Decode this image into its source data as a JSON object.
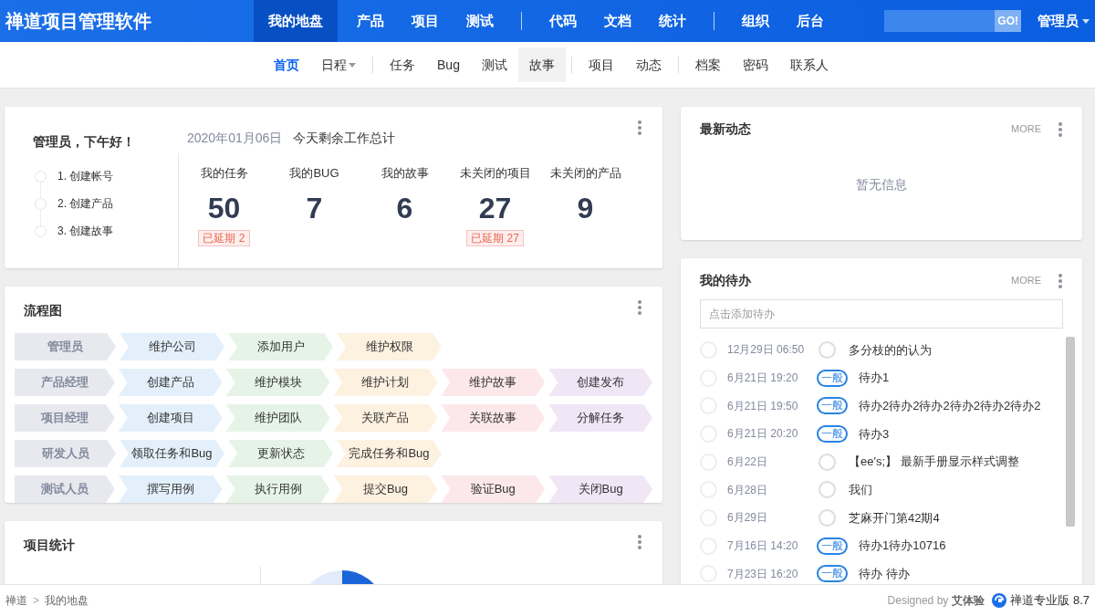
{
  "app": {
    "title": "禅道项目管理软件"
  },
  "nav": {
    "groups": [
      [
        {
          "label": "我的地盘",
          "selected": true
        },
        {
          "label": "产品",
          "selected": false
        },
        {
          "label": "项目",
          "selected": false
        },
        {
          "label": "测试",
          "selected": false
        }
      ],
      [
        {
          "label": "代码",
          "selected": false
        },
        {
          "label": "文档",
          "selected": false
        },
        {
          "label": "统计",
          "selected": false
        }
      ],
      [
        {
          "label": "组织",
          "selected": false
        },
        {
          "label": "后台",
          "selected": false
        }
      ]
    ],
    "search_button": "GO!",
    "user": "管理员"
  },
  "subnav": {
    "groups": [
      [
        {
          "label": "首页",
          "selected": true,
          "dropdown": false,
          "hovered": false
        },
        {
          "label": "日程",
          "selected": false,
          "dropdown": true,
          "hovered": false
        }
      ],
      [
        {
          "label": "任务",
          "selected": false,
          "dropdown": false,
          "hovered": false
        },
        {
          "label": "Bug",
          "selected": false,
          "dropdown": false,
          "hovered": false
        },
        {
          "label": "测试",
          "selected": false,
          "dropdown": false,
          "hovered": false
        },
        {
          "label": "故事",
          "selected": false,
          "dropdown": false,
          "hovered": true
        }
      ],
      [
        {
          "label": "项目",
          "selected": false,
          "dropdown": false,
          "hovered": false
        },
        {
          "label": "动态",
          "selected": false,
          "dropdown": false,
          "hovered": false
        }
      ],
      [
        {
          "label": "档案",
          "selected": false,
          "dropdown": false,
          "hovered": false
        },
        {
          "label": "密码",
          "selected": false,
          "dropdown": false,
          "hovered": false
        },
        {
          "label": "联系人",
          "selected": false,
          "dropdown": false,
          "hovered": false
        }
      ]
    ]
  },
  "welcome": {
    "greeting": "管理员，下午好！",
    "steps": [
      "1. 创建帐号",
      "2. 创建产品",
      "3. 创建故事"
    ],
    "date": "2020年01月06日",
    "summary_title": "今天剩余工作总计",
    "stats": [
      {
        "label": "我的任务",
        "value": "50",
        "overdue": "已延期 2"
      },
      {
        "label": "我的BUG",
        "value": "7"
      },
      {
        "label": "我的故事",
        "value": "6"
      },
      {
        "label": "未关闭的项目",
        "value": "27",
        "overdue": "已延期 27"
      },
      {
        "label": "未关闭的产品",
        "value": "9"
      }
    ]
  },
  "flowchart": {
    "title": "流程图",
    "rows": [
      {
        "role": "管理员",
        "steps": [
          "维护公司",
          "添加用户",
          "维护权限"
        ]
      },
      {
        "role": "产品经理",
        "steps": [
          "创建产品",
          "维护模块",
          "维护计划",
          "维护故事",
          "创建发布"
        ]
      },
      {
        "role": "项目经理",
        "steps": [
          "创建项目",
          "维护团队",
          "关联产品",
          "关联故事",
          "分解任务"
        ]
      },
      {
        "role": "研发人员",
        "steps": [
          "领取任务和Bug",
          "更新状态",
          "完成任务和Bug"
        ]
      },
      {
        "role": "测试人员",
        "steps": [
          "撰写用例",
          "执行用例",
          "提交Bug",
          "验证Bug",
          "关闭Bug"
        ]
      }
    ]
  },
  "project_stats": {
    "title": "项目统计"
  },
  "activity": {
    "title": "最新动态",
    "more": "MORE",
    "empty": "暂无信息"
  },
  "todos": {
    "title": "我的待办",
    "more": "MORE",
    "placeholder": "点击添加待办",
    "items": [
      {
        "date": "12月29日 06:50",
        "title": "多分枝的的认为",
        "checked": false
      },
      {
        "date": "6月21日 19:20",
        "priority": "一般",
        "title": "待办1",
        "checked": false
      },
      {
        "date": "6月21日 19:50",
        "priority": "一般",
        "title": "待办2待办2待办2待办2待办2待办2",
        "checked": false
      },
      {
        "date": "6月21日 20:20",
        "priority": "一般",
        "title": "待办3",
        "checked": false
      },
      {
        "date": "6月22日",
        "title": "【ee's;】 最新手册显示样式调整",
        "checked": false
      },
      {
        "date": "6月28日",
        "title": "我们",
        "checked": false
      },
      {
        "date": "6月29日",
        "title": "芝麻开门第42期4",
        "checked": false
      },
      {
        "date": "7月16日 14:20",
        "priority": "一般",
        "title": "待办1待办10716",
        "checked": false
      },
      {
        "date": "7月23日 16:20",
        "priority": "一般",
        "title": "待办 待办",
        "checked": false
      }
    ]
  },
  "footer": {
    "breadcrumb": [
      "禅道",
      "我的地盘"
    ],
    "separator": ">",
    "designed_by": "Designed by",
    "designer": "艾体验",
    "version": "禅道专业版 8.7"
  }
}
